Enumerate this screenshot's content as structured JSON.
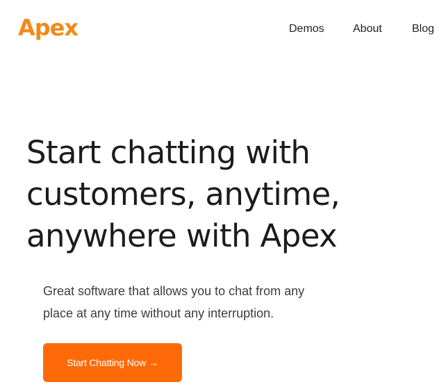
{
  "header": {
    "logo_text": "Apex",
    "nav": [
      {
        "label": "Demos"
      },
      {
        "label": "About"
      },
      {
        "label": "Blog"
      }
    ]
  },
  "hero": {
    "title_lines": [
      "Start chatting with",
      "customers, anytime,",
      "anywhere with Apex"
    ],
    "subtitle_lines": [
      "Great software that allows you to chat from any",
      "place at any time without any interruption."
    ],
    "cta": {
      "label": "Start Chatting Now",
      "icon": "arrow-right-icon",
      "color": "#fe6a08"
    }
  },
  "colors": {
    "logo": "#f28a1a",
    "text_dark": "#1b1c20",
    "text_body": "#3b3d42",
    "background": "#ffffff"
  }
}
